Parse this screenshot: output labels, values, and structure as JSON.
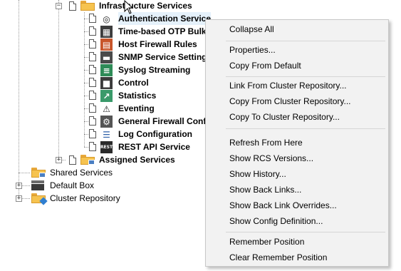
{
  "tree": {
    "infrastructure_services": "Infrastructure Services",
    "children": [
      {
        "label": "Authentication Service",
        "icon": "fingerprint-icon"
      },
      {
        "label": "Time-based OTP Bulk",
        "icon": "otp-icon"
      },
      {
        "label": "Host Firewall Rules",
        "icon": "firewall-icon"
      },
      {
        "label": "SNMP Service Setting",
        "icon": "snmp-icon"
      },
      {
        "label": "Syslog Streaming",
        "icon": "syslog-icon"
      },
      {
        "label": "Control",
        "icon": "control-icon"
      },
      {
        "label": "Statistics",
        "icon": "statistics-icon"
      },
      {
        "label": "Eventing",
        "icon": "warning-icon"
      },
      {
        "label": "General Firewall Conf",
        "icon": "firewall-config-icon"
      },
      {
        "label": "Log Configuration",
        "icon": "log-icon"
      },
      {
        "label": "REST API Service",
        "icon": "rest-icon"
      }
    ],
    "assigned_services": "Assigned Services",
    "shared_services": "Shared Services",
    "default_box": "Default Box",
    "cluster_repository": "Cluster Repository",
    "rest_icon_text": "REST"
  },
  "menu": {
    "collapse_all": "Collapse All",
    "properties": "Properties...",
    "copy_from_default": "Copy From Default",
    "link_from_cluster": "Link From Cluster Repository...",
    "copy_from_cluster": "Copy From Cluster Repository...",
    "copy_to_cluster": "Copy To Cluster Repository...",
    "refresh_from_here": "Refresh From Here",
    "show_rcs_versions": "Show RCS Versions...",
    "show_history": "Show History...",
    "show_back_links": "Show Back Links...",
    "show_back_link_overrides": "Show Back Link Overrides...",
    "show_config_definition": "Show Config Definition...",
    "remember_position": "Remember Position",
    "clear_remember_position": "Clear Remember Position"
  },
  "colors": {
    "selection": "#e5f1fb",
    "folder": "#f6c34f",
    "menu_bg": "#f2f2f2"
  }
}
